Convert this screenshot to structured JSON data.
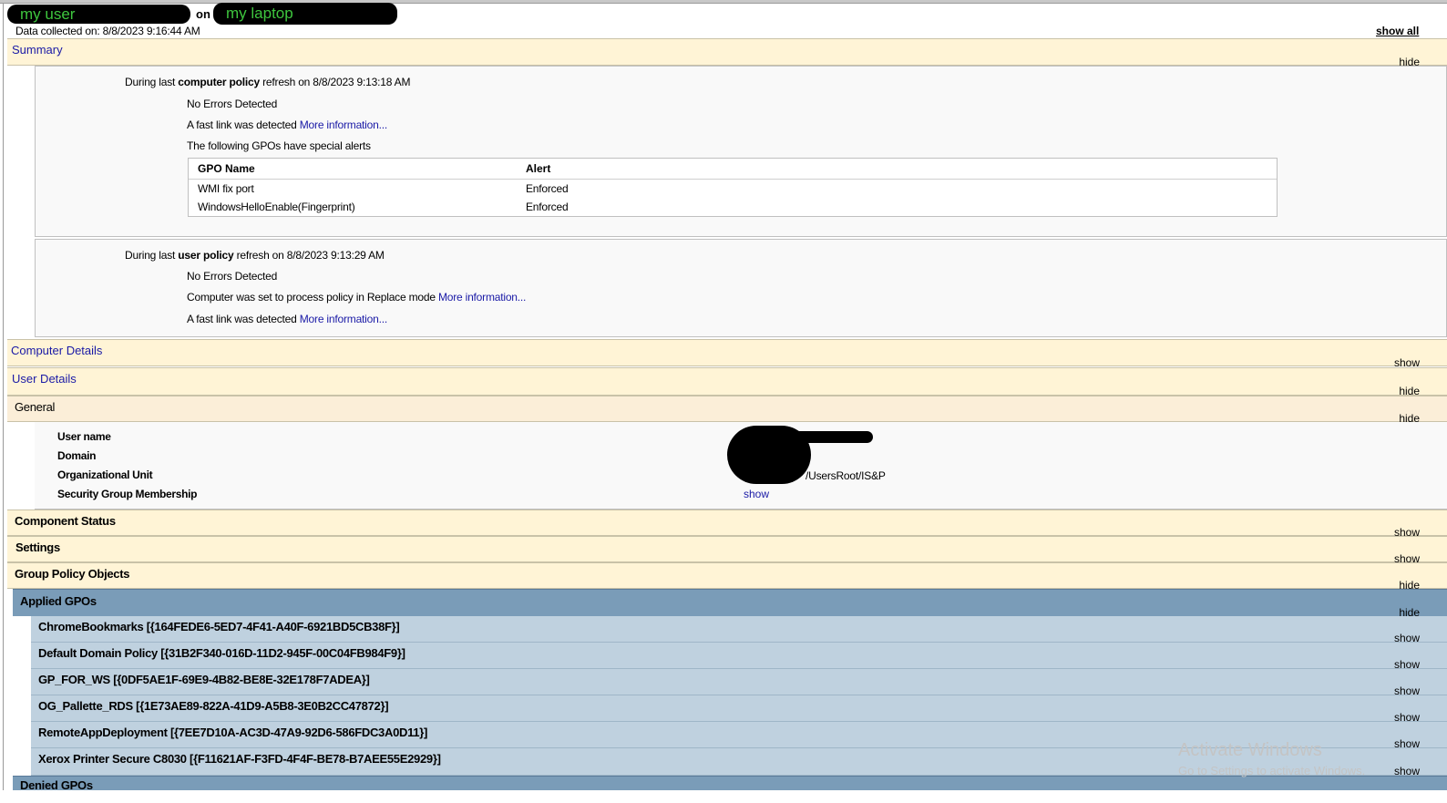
{
  "header": {
    "user_label": "my user",
    "on_label": "on",
    "computer_label": "my laptop",
    "collected": "Data collected on: 8/8/2023 9:16:44 AM",
    "show_all": "show all"
  },
  "summary": {
    "title": "Summary",
    "toggle": "hide",
    "computer": {
      "prefix": "During last ",
      "kind": "computer policy",
      "suffix": " refresh on 8/8/2023 9:13:18 AM",
      "errors": "No Errors Detected",
      "fastlink_text": "A fast link was detected ",
      "fastlink_link": "More information...",
      "alerts_intro": "The following GPOs have special alerts",
      "table_headers": [
        "GPO Name",
        "Alert"
      ],
      "table_rows": [
        [
          "WMI fix port",
          "Enforced"
        ],
        [
          "WindowsHelloEnable(Fingerprint)",
          "Enforced"
        ]
      ]
    },
    "user": {
      "prefix": "During last ",
      "kind": "user policy",
      "suffix": " refresh on 8/8/2023 9:13:29 AM",
      "errors": "No Errors Detected",
      "replace_text": "Computer was set to process policy in Replace mode ",
      "replace_link": "More information...",
      "fastlink_text": "A fast link was detected ",
      "fastlink_link": "More information..."
    }
  },
  "computer_details": {
    "title": "Computer Details",
    "toggle": "show"
  },
  "user_details": {
    "title": "User Details",
    "toggle": "hide"
  },
  "general": {
    "title": "General",
    "toggle": "hide",
    "fields": [
      {
        "label": "User name",
        "value": ""
      },
      {
        "label": "Domain",
        "value": ""
      },
      {
        "label": "Organizational Unit",
        "value": "/UsersRoot/IS&P"
      },
      {
        "label": "Security Group Membership",
        "value": "show"
      }
    ]
  },
  "component_status": {
    "title": "Component Status",
    "toggle": "show"
  },
  "settings": {
    "title": "Settings",
    "toggle": "show"
  },
  "gpos": {
    "title": "Group Policy Objects",
    "toggle": "hide"
  },
  "applied": {
    "title": "Applied GPOs",
    "toggle": "hide",
    "items": [
      {
        "name": "ChromeBookmarks [{164FEDE6-5ED7-4F41-A40F-6921BD5CB38F}]",
        "toggle": "show"
      },
      {
        "name": "Default Domain Policy [{31B2F340-016D-11D2-945F-00C04FB984F9}]",
        "toggle": "show"
      },
      {
        "name": "GP_FOR_WS [{0DF5AE1F-69E9-4B82-BE8E-32E178F7ADEA}]",
        "toggle": "show"
      },
      {
        "name": "OG_Pallette_RDS [{1E73AE89-822A-41D9-A5B8-3E0B2CC47872}]",
        "toggle": "show"
      },
      {
        "name": "RemoteAppDeployment [{7EE7D10A-AC3D-47A9-92D6-586FDC3A0D11}]",
        "toggle": "show"
      },
      {
        "name": "Xerox Printer Secure C8030 [{F11621AF-F3FD-4F4F-BE78-B7AEE55E2929}]",
        "toggle": "show"
      }
    ]
  },
  "denied": {
    "title": "Denied GPOs"
  },
  "watermark": {
    "line1": "Activate Windows",
    "line2": "Go to Settings to activate Windows."
  }
}
